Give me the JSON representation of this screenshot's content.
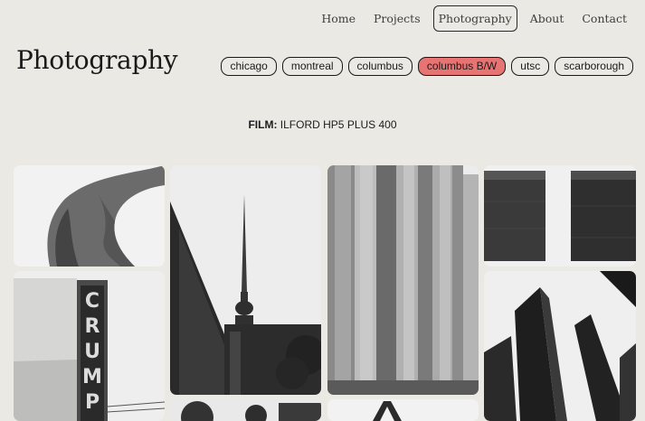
{
  "nav": {
    "items": [
      {
        "label": "Home"
      },
      {
        "label": "Projects"
      },
      {
        "label": "Photography",
        "active": true
      },
      {
        "label": "About"
      },
      {
        "label": "Contact"
      }
    ]
  },
  "page": {
    "title": "Photography"
  },
  "filters": [
    {
      "label": "chicago"
    },
    {
      "label": "montreal"
    },
    {
      "label": "columbus"
    },
    {
      "label": "columbus B/W",
      "active": true
    },
    {
      "label": "utsc"
    },
    {
      "label": "scarborough"
    }
  ],
  "film": {
    "label": "FILM:",
    "value": " ILFORD HP5 PLUS 400"
  },
  "colors": {
    "background": "#ebe9e4",
    "active_chip": "#e87373",
    "text": "#1c1c1c"
  },
  "gallery": {
    "style": "black-and-white"
  }
}
